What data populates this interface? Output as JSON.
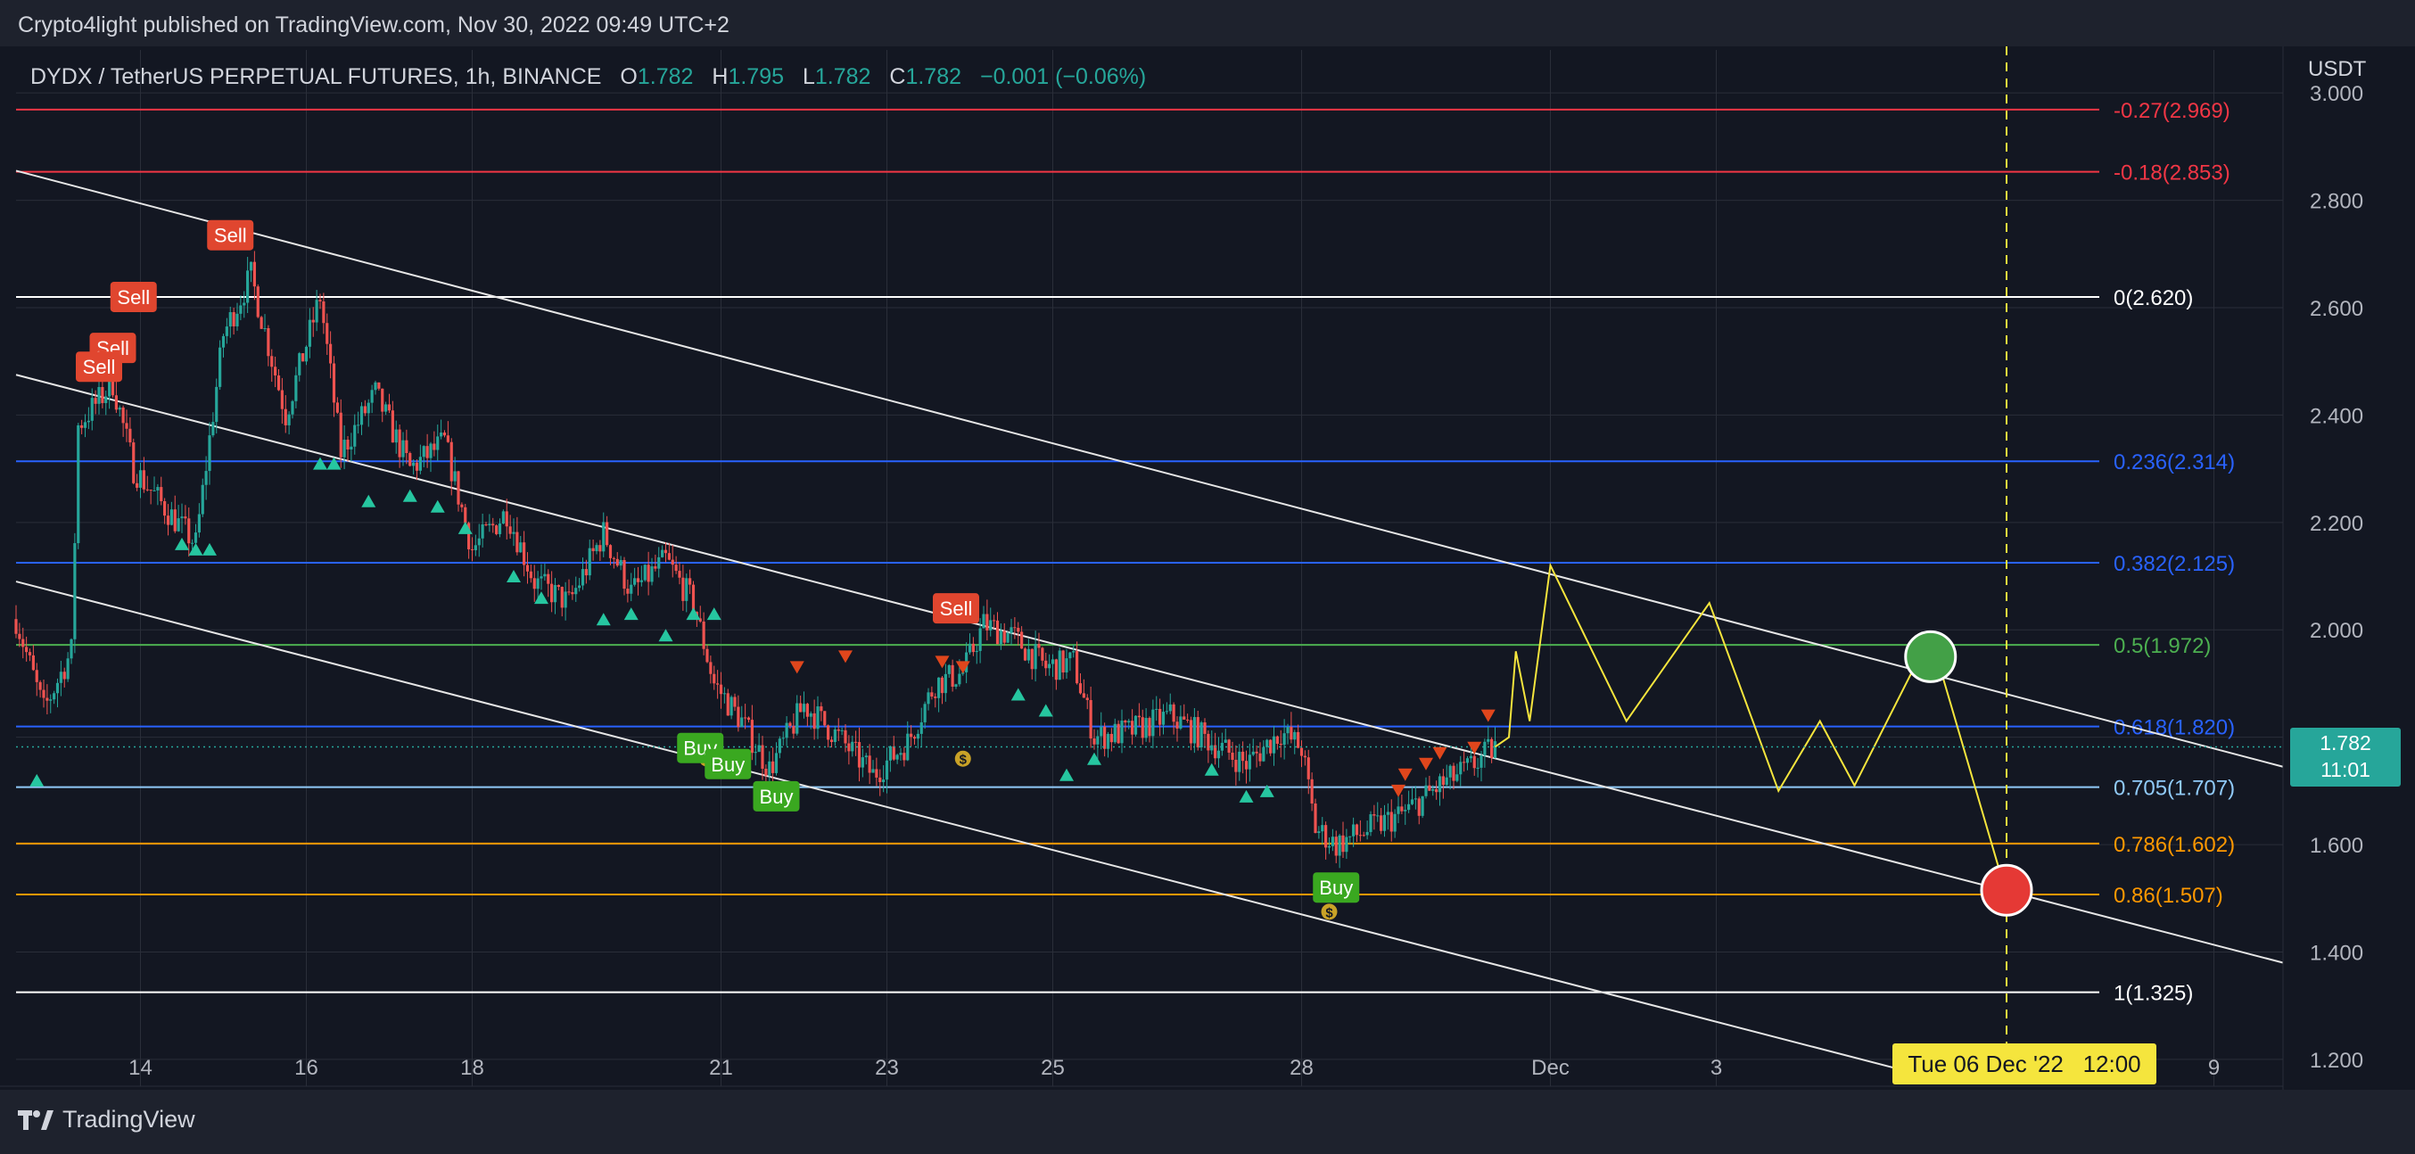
{
  "header": {
    "published": "Crypto4light published on TradingView.com, Nov 30, 2022 09:49 UTC+2"
  },
  "legend": {
    "symbol": "DYDX / TetherUS PERPETUAL FUTURES, 1h, BINANCE",
    "o_label": "O",
    "o_value": "1.782",
    "h_label": "H",
    "h_value": "1.795",
    "l_label": "L",
    "l_value": "1.782",
    "c_label": "C",
    "c_value": "1.782",
    "change": "−0.001 (−0.06%)"
  },
  "axis": {
    "unit": "USDT"
  },
  "last_price": {
    "price": "1.782",
    "countdown": "11:01"
  },
  "crosshair": {
    "date_label": "Tue 06 Dec '22   12:00"
  },
  "footer": {
    "brand": "TradingView"
  },
  "colors": {
    "up": "#26a69a",
    "down": "#ef5350",
    "background": "#131722",
    "projection": "#f5e53d",
    "target_green": "#43a047",
    "target_red": "#e53935"
  },
  "chart_data": {
    "type": "candlestick",
    "ylim": [
      1.15,
      3.08
    ],
    "xlim": [
      "2022-11-12T12:00",
      "2022-12-09T20:00"
    ],
    "y_ticks": [
      "3.000",
      "2.800",
      "2.600",
      "2.400",
      "2.200",
      "2.000",
      "1.800",
      "1.600",
      "1.400",
      "1.200"
    ],
    "x_ticks": [
      {
        "date": "2022-11-14",
        "label": "14"
      },
      {
        "date": "2022-11-16",
        "label": "16"
      },
      {
        "date": "2022-11-18",
        "label": "18"
      },
      {
        "date": "2022-11-21",
        "label": "21"
      },
      {
        "date": "2022-11-23",
        "label": "23"
      },
      {
        "date": "2022-11-25",
        "label": "25"
      },
      {
        "date": "2022-11-28",
        "label": "28"
      },
      {
        "date": "2022-12-01",
        "label": "Dec"
      },
      {
        "date": "2022-12-03",
        "label": "3"
      },
      {
        "date": "2022-12-09",
        "label": "9"
      }
    ],
    "fib_levels": [
      {
        "label": "-0.27(2.969)",
        "value": 2.969,
        "color": "#f23645"
      },
      {
        "label": "-0.18(2.853)",
        "value": 2.853,
        "color": "#f23645"
      },
      {
        "label": "0(2.620)",
        "value": 2.62,
        "color": "#ffffff"
      },
      {
        "label": "0.236(2.314)",
        "value": 2.314,
        "color": "#2962ff"
      },
      {
        "label": "0.382(2.125)",
        "value": 2.125,
        "color": "#2962ff"
      },
      {
        "label": "0.5(1.972)",
        "value": 1.972,
        "color": "#4caf50"
      },
      {
        "label": "0.618(1.820)",
        "value": 1.82,
        "color": "#2962ff"
      },
      {
        "label": "0.705(1.707)",
        "value": 1.707,
        "color": "#90caf9"
      },
      {
        "label": "0.786(1.602)",
        "value": 1.602,
        "color": "#ff9800"
      },
      {
        "label": "0.86(1.507)",
        "value": 1.507,
        "color": "#ff9800"
      },
      {
        "label": "1(1.325)",
        "value": 1.325,
        "color": "#ffffff"
      }
    ],
    "channel_lines": [
      {
        "from": [
          "2022-11-12T12:00",
          2.855
        ],
        "to": [
          "2022-12-09T20:00",
          1.745
        ]
      },
      {
        "from": [
          "2022-11-12T12:00",
          2.475
        ],
        "to": [
          "2022-12-09T20:00",
          1.38
        ]
      },
      {
        "from": [
          "2022-11-12T12:00",
          2.09
        ],
        "to": [
          "2022-12-05T18:00",
          1.16
        ]
      }
    ],
    "price_path": [
      [
        "2022-11-12T12:00",
        2.02
      ],
      [
        "2022-11-12T20:00",
        1.85
      ],
      [
        "2022-11-13T04:00",
        1.96
      ],
      [
        "2022-11-13T06:00",
        2.38
      ],
      [
        "2022-11-13T16:00",
        2.46
      ],
      [
        "2022-11-13T22:00",
        2.3
      ],
      [
        "2022-11-14T08:00",
        2.22
      ],
      [
        "2022-11-14T16:00",
        2.16
      ],
      [
        "2022-11-15T00:00",
        2.55
      ],
      [
        "2022-11-15T08:00",
        2.66
      ],
      [
        "2022-11-15T18:00",
        2.4
      ],
      [
        "2022-11-16T04:00",
        2.62
      ],
      [
        "2022-11-16T10:00",
        2.33
      ],
      [
        "2022-11-16T20:00",
        2.44
      ],
      [
        "2022-11-17T06:00",
        2.3
      ],
      [
        "2022-11-17T16:00",
        2.35
      ],
      [
        "2022-11-18T00:00",
        2.15
      ],
      [
        "2022-11-18T10:00",
        2.22
      ],
      [
        "2022-11-18T18:00",
        2.09
      ],
      [
        "2022-11-19T04:00",
        2.05
      ],
      [
        "2022-11-19T14:00",
        2.18
      ],
      [
        "2022-11-19T22:00",
        2.07
      ],
      [
        "2022-11-20T08:00",
        2.13
      ],
      [
        "2022-11-20T16:00",
        2.05
      ],
      [
        "2022-11-20T22:00",
        1.9
      ],
      [
        "2022-11-21T06:00",
        1.83
      ],
      [
        "2022-11-21T14:00",
        1.74
      ],
      [
        "2022-11-22T00:00",
        1.86
      ],
      [
        "2022-11-22T10:00",
        1.8
      ],
      [
        "2022-11-22T20:00",
        1.73
      ],
      [
        "2022-11-23T06:00",
        1.79
      ],
      [
        "2022-11-23T14:00",
        1.9
      ],
      [
        "2022-11-23T22:00",
        1.92
      ],
      [
        "2022-11-24T04:00",
        2.01
      ],
      [
        "2022-11-24T12:00",
        1.99
      ],
      [
        "2022-11-24T22:00",
        1.93
      ],
      [
        "2022-11-25T06:00",
        1.94
      ],
      [
        "2022-11-25T12:00",
        1.8
      ],
      [
        "2022-11-25T22:00",
        1.81
      ],
      [
        "2022-11-26T10:00",
        1.84
      ],
      [
        "2022-11-26T22:00",
        1.79
      ],
      [
        "2022-11-27T08:00",
        1.75
      ],
      [
        "2022-11-27T18:00",
        1.81
      ],
      [
        "2022-11-28T00:00",
        1.78
      ],
      [
        "2022-11-28T04:00",
        1.63
      ],
      [
        "2022-11-28T10:00",
        1.6
      ],
      [
        "2022-11-28T20:00",
        1.63
      ],
      [
        "2022-11-29T06:00",
        1.66
      ],
      [
        "2022-11-29T16:00",
        1.71
      ],
      [
        "2022-11-30T00:00",
        1.74
      ],
      [
        "2022-11-30T08:00",
        1.782
      ]
    ],
    "projection_path": [
      [
        "2022-11-30T08:00",
        1.782
      ],
      [
        "2022-11-30T12:00",
        1.8
      ],
      [
        "2022-11-30T14:00",
        1.96
      ],
      [
        "2022-11-30T18:00",
        1.83
      ],
      [
        "2022-12-01T00:00",
        2.12
      ],
      [
        "2022-12-01T22:00",
        1.83
      ],
      [
        "2022-12-02T22:00",
        2.05
      ],
      [
        "2022-12-03T18:00",
        1.7
      ],
      [
        "2022-12-04T06:00",
        1.83
      ],
      [
        "2022-12-04T16:00",
        1.71
      ],
      [
        "2022-12-05T14:00",
        1.99
      ],
      [
        "2022-12-06T12:00",
        1.507
      ]
    ],
    "targets": [
      {
        "date": "2022-12-05T14:00",
        "value": 1.95,
        "color": "#43a047"
      },
      {
        "date": "2022-12-06T12:00",
        "value": 1.515,
        "color": "#e53935"
      }
    ],
    "crosshair_date": "2022-12-06T12:00",
    "last_price_value": 1.782,
    "signals": [
      {
        "type": "sell",
        "label": "Sell",
        "date": "2022-11-15T02:00",
        "value": 2.735
      },
      {
        "type": "sell",
        "label": "Sell",
        "date": "2022-11-13T22:00",
        "value": 2.62
      },
      {
        "type": "sell",
        "label": "Sell",
        "date": "2022-11-13T16:00",
        "value": 2.525
      },
      {
        "type": "sell",
        "label": "Sell",
        "date": "2022-11-13T12:00",
        "value": 2.49
      },
      {
        "type": "sell",
        "label": "Sell",
        "date": "2022-11-23T20:00",
        "value": 2.04
      },
      {
        "type": "buy",
        "label": "Buy",
        "date": "2022-11-20T18:00",
        "value": 1.78
      },
      {
        "type": "buy",
        "label": "Buy",
        "date": "2022-11-21T02:00",
        "value": 1.75
      },
      {
        "type": "buy",
        "label": "Buy",
        "date": "2022-11-21T16:00",
        "value": 1.69
      },
      {
        "type": "buy",
        "label": "Buy",
        "date": "2022-11-28T10:00",
        "value": 1.52
      }
    ],
    "up_arrows": [
      [
        "2022-11-12T18:00",
        1.72
      ],
      [
        "2022-11-14T12:00",
        2.16
      ],
      [
        "2022-11-14T16:00",
        2.15
      ],
      [
        "2022-11-14T20:00",
        2.15
      ],
      [
        "2022-11-16T04:00",
        2.31
      ],
      [
        "2022-11-16T08:00",
        2.31
      ],
      [
        "2022-11-16T18:00",
        2.24
      ],
      [
        "2022-11-17T06:00",
        2.25
      ],
      [
        "2022-11-17T14:00",
        2.23
      ],
      [
        "2022-11-17T22:00",
        2.19
      ],
      [
        "2022-11-18T12:00",
        2.1
      ],
      [
        "2022-11-18T20:00",
        2.06
      ],
      [
        "2022-11-19T14:00",
        2.02
      ],
      [
        "2022-11-19T22:00",
        2.03
      ],
      [
        "2022-11-20T08:00",
        1.99
      ],
      [
        "2022-11-20T16:00",
        2.03
      ],
      [
        "2022-11-20T22:00",
        2.03
      ],
      [
        "2022-11-24T14:00",
        1.88
      ],
      [
        "2022-11-24T22:00",
        1.85
      ],
      [
        "2022-11-25T04:00",
        1.73
      ],
      [
        "2022-11-25T12:00",
        1.76
      ],
      [
        "2022-11-26T22:00",
        1.74
      ],
      [
        "2022-11-27T08:00",
        1.69
      ],
      [
        "2022-11-27T14:00",
        1.7
      ]
    ],
    "down_arrows": [
      [
        "2022-11-21T22:00",
        1.93
      ],
      [
        "2022-11-22T12:00",
        1.95
      ],
      [
        "2022-11-23T16:00",
        1.94
      ],
      [
        "2022-11-23T22:00",
        1.93
      ],
      [
        "2022-11-29T04:00",
        1.7
      ],
      [
        "2022-11-29T06:00",
        1.73
      ],
      [
        "2022-11-29T12:00",
        1.75
      ],
      [
        "2022-11-29T16:00",
        1.77
      ],
      [
        "2022-11-30T02:00",
        1.78
      ],
      [
        "2022-11-30T06:00",
        1.84
      ]
    ],
    "coin_markers": [
      [
        "2022-11-20T20:00",
        1.76
      ],
      [
        "2022-11-23T22:00",
        1.76
      ],
      [
        "2022-11-28T08:00",
        1.475
      ]
    ]
  }
}
